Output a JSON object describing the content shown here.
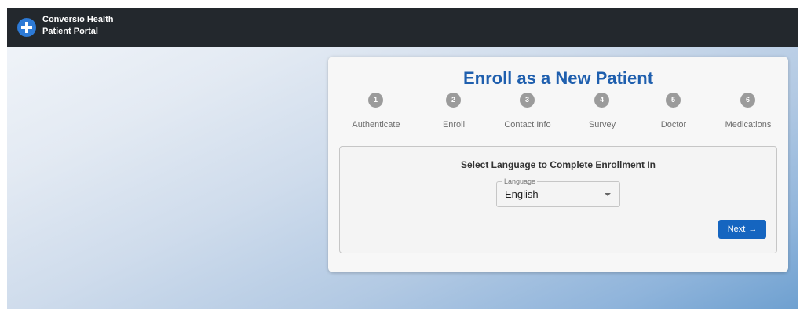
{
  "header": {
    "brand_line1": "Conversio Health",
    "brand_line2": "Patient Portal",
    "logo_icon": "plus-circle-icon"
  },
  "card": {
    "title": "Enroll as a New Patient"
  },
  "steps": [
    {
      "number": "1",
      "label": "Authenticate"
    },
    {
      "number": "2",
      "label": "Enroll"
    },
    {
      "number": "3",
      "label": "Contact Info"
    },
    {
      "number": "4",
      "label": "Survey"
    },
    {
      "number": "5",
      "label": "Doctor"
    },
    {
      "number": "6",
      "label": "Medications"
    }
  ],
  "form": {
    "prompt": "Select Language to Complete Enrollment In",
    "language_label": "Language",
    "language_value": "English",
    "next_label": "Next",
    "next_icon": "→"
  },
  "colors": {
    "topbar": "#23282d",
    "accent": "#1f5fae",
    "button": "#1565c0",
    "step_circle": "#9b9b9b"
  }
}
